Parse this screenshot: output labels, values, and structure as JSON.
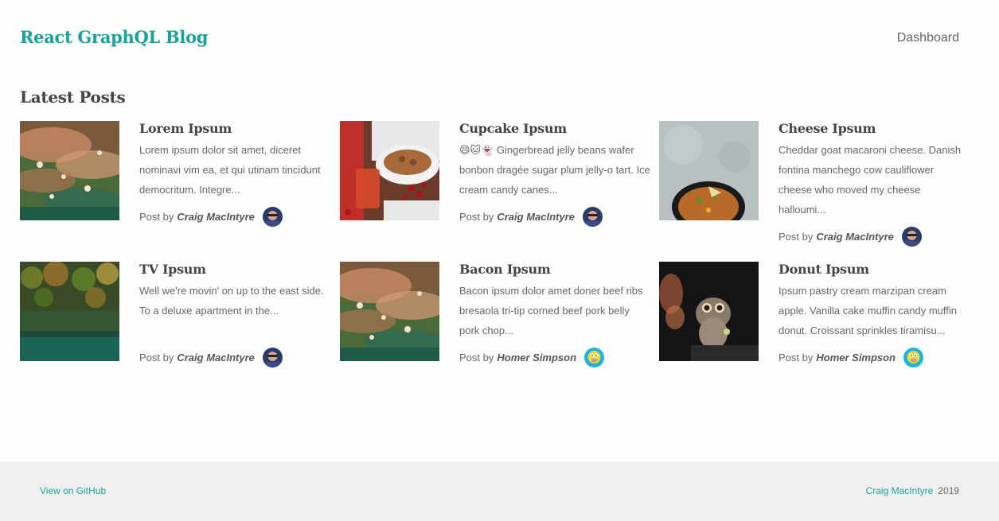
{
  "header": {
    "brand": "React GraphQL Blog",
    "nav_dashboard": "Dashboard"
  },
  "main": {
    "section_title": "Latest Posts",
    "posted_by_label": "Post by",
    "posts": [
      {
        "title": "Lorem Ipsum",
        "excerpt": "Lorem ipsum dolor sit amet, diceret nominavi vim ea, et qui utinam tincidunt democritum. Integre...",
        "author": "Craig MacIntyre",
        "image": "flowers-field",
        "avatar": "craig-avatar"
      },
      {
        "title": "Cupcake Ipsum",
        "excerpt": "😄🐱👻 Gingerbread jelly beans wafer bonbon dragée sugar plum jelly-o tart. Ice cream candy canes...",
        "author": "Craig MacIntyre",
        "image": "berries-and-drink",
        "avatar": "craig-avatar"
      },
      {
        "title": "Cheese Ipsum",
        "excerpt": "Cheddar goat macaroni cheese. Danish fontina manchego cow cauliflower cheese who moved my cheese halloumi...",
        "author": "Craig MacIntyre",
        "image": "food-bowl",
        "avatar": "craig-avatar"
      },
      {
        "title": "TV Ipsum",
        "excerpt": "Well we're movin' on up to the east side. To a deluxe apartment in the...",
        "author": "Craig MacIntyre",
        "image": "forest-lake",
        "avatar": "craig-avatar"
      },
      {
        "title": "Bacon Ipsum",
        "excerpt": "Bacon ipsum dolor amet doner beef ribs bresaola tri-tip corned beef pork belly pork chop...",
        "author": "Homer Simpson",
        "image": "flowers-field",
        "avatar": "homer-avatar"
      },
      {
        "title": "Donut Ipsum",
        "excerpt": "Ipsum pastry cream marzipan cream apple. Vanilla cake muffin candy muffin donut. Croissant sprinkles tiramisu...",
        "author": "Homer Simpson",
        "image": "slow-loris",
        "avatar": "homer-avatar"
      }
    ]
  },
  "footer": {
    "github_link": "View on GitHub",
    "credit_name": "Craig MacIntyre",
    "year": "2019"
  },
  "colors": {
    "accent": "#17a398",
    "footer_bg": "#f0f0f0",
    "page_bg": "#fdfdfd"
  }
}
